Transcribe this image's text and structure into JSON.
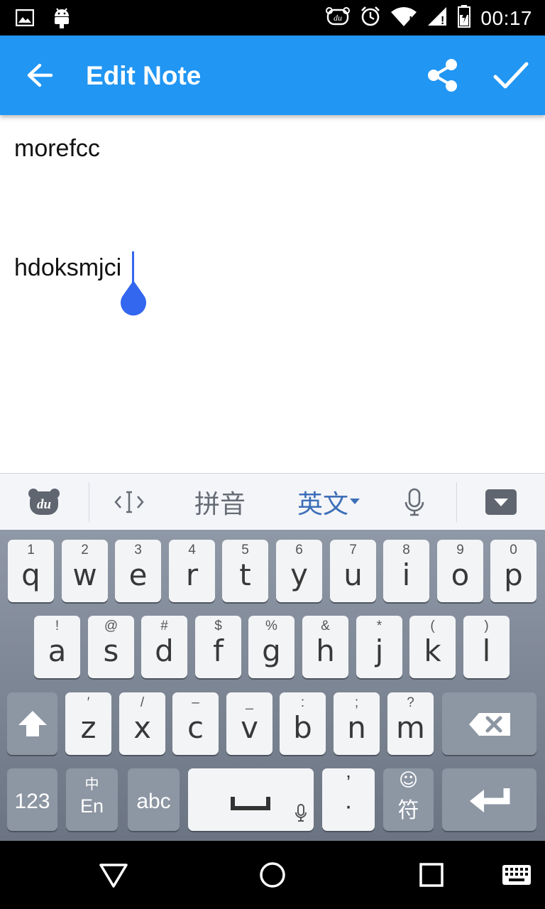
{
  "status_bar": {
    "time": "00:17",
    "icons": [
      "image-icon",
      "android-icon",
      "du-bear-icon",
      "alarm-icon",
      "wifi-icon",
      "signal-icon",
      "battery-icon"
    ]
  },
  "app_bar": {
    "title": "Edit Note",
    "back_icon": "arrow-back-icon",
    "share_icon": "share-icon",
    "done_icon": "check-icon",
    "color": "#2196f3"
  },
  "note": {
    "line1": "morefcc",
    "line2": "hdoksmjci"
  },
  "ime_bar": {
    "logo": "du",
    "cursor_icon": "cursor-move-icon",
    "pinyin": "拼音",
    "english": "英文",
    "mic_icon": "microphone-icon",
    "hide_icon": "keyboard-hide-icon"
  },
  "keyboard": {
    "row1": [
      {
        "sub": "1",
        "main": "q"
      },
      {
        "sub": "2",
        "main": "w"
      },
      {
        "sub": "3",
        "main": "e"
      },
      {
        "sub": "4",
        "main": "r"
      },
      {
        "sub": "5",
        "main": "t"
      },
      {
        "sub": "6",
        "main": "y"
      },
      {
        "sub": "7",
        "main": "u"
      },
      {
        "sub": "8",
        "main": "i"
      },
      {
        "sub": "9",
        "main": "o"
      },
      {
        "sub": "0",
        "main": "p"
      }
    ],
    "row2": [
      {
        "sub": "!",
        "main": "a"
      },
      {
        "sub": "@",
        "main": "s"
      },
      {
        "sub": "#",
        "main": "d"
      },
      {
        "sub": "$",
        "main": "f"
      },
      {
        "sub": "%",
        "main": "g"
      },
      {
        "sub": "&",
        "main": "h"
      },
      {
        "sub": "*",
        "main": "j"
      },
      {
        "sub": "(",
        "main": "k"
      },
      {
        "sub": ")",
        "main": "l"
      }
    ],
    "row3": [
      {
        "sub": "′",
        "main": "z"
      },
      {
        "sub": "/",
        "main": "x"
      },
      {
        "sub": "–",
        "main": "c"
      },
      {
        "sub": "_",
        "main": "v"
      },
      {
        "sub": ":",
        "main": "b"
      },
      {
        "sub": ";",
        "main": "n"
      },
      {
        "sub": "?",
        "main": "m"
      }
    ],
    "num_label": "123",
    "lang_top": "中",
    "lang_bottom": "En",
    "abc_label": "abc",
    "punct_top": "’",
    "punct_bottom": "·",
    "symbol_top": "☺",
    "symbol_bottom": "符",
    "shift_icon": "shift-icon",
    "backspace_icon": "backspace-icon",
    "space_icon": "space-bar-icon",
    "enter_icon": "enter-icon"
  },
  "nav_bar": {
    "icons": [
      "back-triangle-icon",
      "home-circle-icon",
      "recents-square-icon",
      "keyboard-switch-icon"
    ]
  }
}
